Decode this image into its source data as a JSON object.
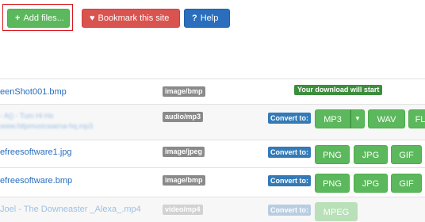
{
  "toolbar": {
    "add_files": {
      "icon": "plus-icon",
      "glyph": "+",
      "label": "Add files..."
    },
    "bookmark": {
      "icon": "heart-icon",
      "glyph": "♥",
      "label": "Bookmark this site"
    },
    "help": {
      "icon": "help-icon",
      "glyph": "?",
      "label": "Help"
    }
  },
  "download_notice": "Your download will start",
  "convert_label": "Convert to:",
  "files": [
    {
      "name": "eenShot001.bmp",
      "mime": "image/bmp"
    },
    {
      "name": "- A() - Tum Hi Ho",
      "name2": "www.hitpmusicwarna-hq.mp3",
      "mime": "audio/mp3",
      "formats": [
        "MP3",
        "WAV",
        "FL"
      ]
    },
    {
      "name": "efreesoftware1.jpg",
      "mime": "image/jpeg",
      "formats": [
        "PNG",
        "JPG",
        "GIF"
      ]
    },
    {
      "name": "efreesoftware.bmp",
      "mime": "image/bmp",
      "formats": [
        "PNG",
        "JPG",
        "GIF"
      ]
    },
    {
      "name": "Joel - The Downeaster _Alexa_.mp4",
      "mime": "video/mp4",
      "formats": [
        "MPEG"
      ]
    }
  ],
  "colors": {
    "green": "#5cb85c",
    "red": "#d9534f",
    "blue": "#2a6ebd",
    "highlight": "#d9191f"
  }
}
